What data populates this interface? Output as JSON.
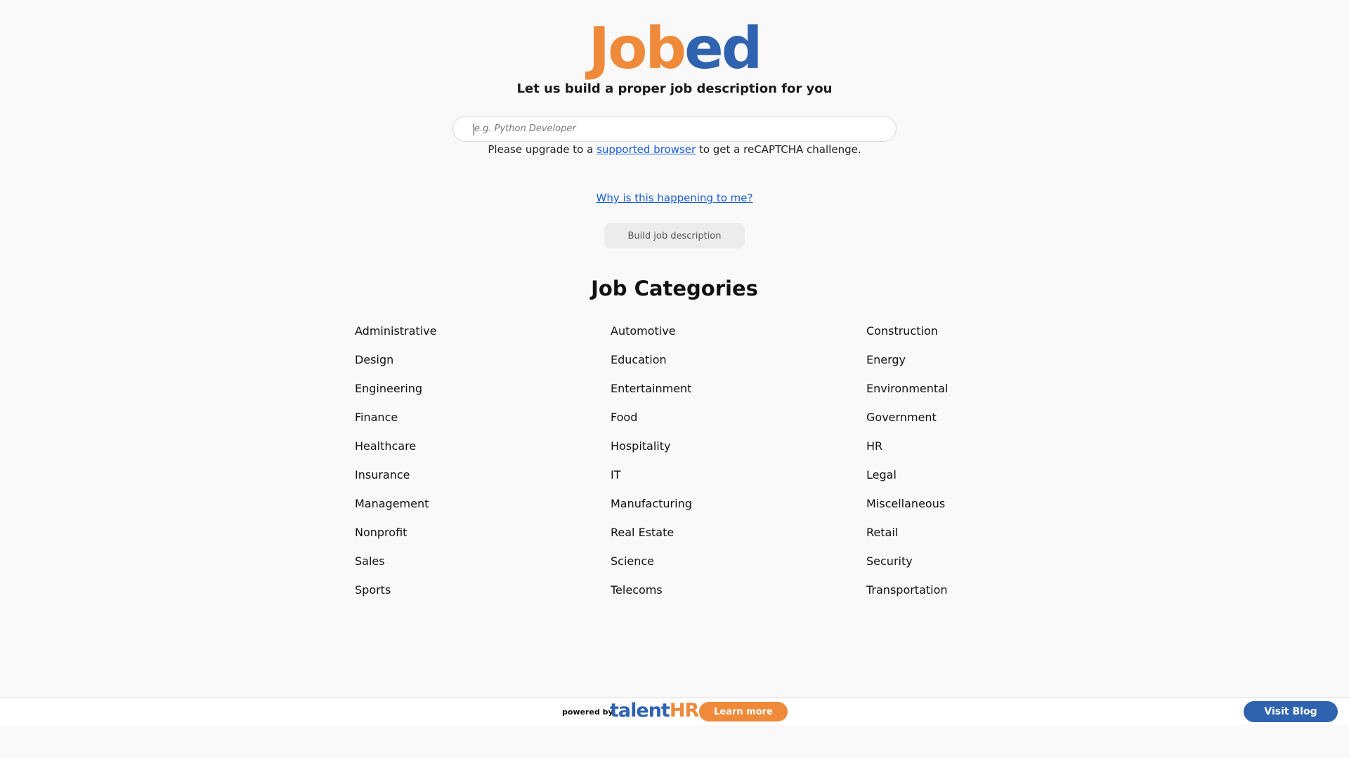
{
  "logo": {
    "part1": "Job",
    "part2": "ed"
  },
  "tagline": "Let us build a proper job description for you",
  "search": {
    "placeholder": "e.g. Python Developer",
    "value": ""
  },
  "recaptcha": {
    "before": "Please upgrade to a ",
    "link": "supported browser",
    "after": " to get a reCAPTCHA challenge."
  },
  "why_link": "Why is this happening to me?",
  "build_button": "Build job description",
  "categories_title": "Job Categories",
  "categories": [
    "Administrative",
    "Automotive",
    "Construction",
    "Design",
    "Education",
    "Energy",
    "Engineering",
    "Entertainment",
    "Environmental",
    "Finance",
    "Food",
    "Government",
    "Healthcare",
    "Hospitality",
    "HR",
    "Insurance",
    "IT",
    "Legal",
    "Management",
    "Manufacturing",
    "Miscellaneous",
    "Nonprofit",
    "Real Estate",
    "Retail",
    "Sales",
    "Science",
    "Security",
    "Sports",
    "Telecoms",
    "Transportation"
  ],
  "footer": {
    "powered_by": "powered by",
    "brand_part1": "talent",
    "brand_part2": "HR",
    "learn_more": "Learn more",
    "visit_blog": "Visit Blog"
  },
  "colors": {
    "orange": "#ee8a3a",
    "blue": "#2f63b0",
    "link": "#1a5dd6"
  }
}
